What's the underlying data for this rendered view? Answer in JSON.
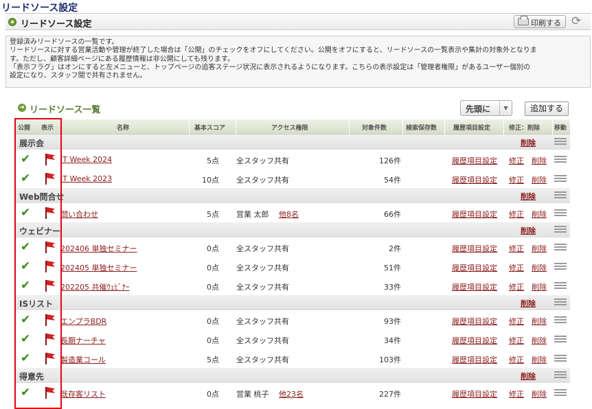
{
  "page_title": "リードソース設定",
  "section_title": "リードソース設定",
  "print_label": "印刷する",
  "description": [
    "登録済みリードソースの一覧です。",
    "リードソースに対する営業活動や管理が終了した場合は「公開」のチェックをオフにしてください。公開をオフにすると、リードソースの一覧表示や集計の対象外となりま",
    "す。ただし、顧客詳細ページにある履歴情報は非公開にしても残ります。",
    "「表示フラグ」はオンにすると左メニューと、トップページの追客ステージ状況に表示されるようになります。こちらの表示設定は「管理者権限」があるユーザー個別の",
    "設定になり、スタッフ間で共有されません。"
  ],
  "list_title": "リードソース一覧",
  "order_select": "先頭に",
  "add_button": "追加する",
  "headers": {
    "public": "公開",
    "display": "表示",
    "name": "名称",
    "score": "基本スコア",
    "access": "アクセス権限",
    "count": "対象件数",
    "saved": "検索保存数",
    "history": "履歴項目設定",
    "edit_delete": "修正：削除",
    "move": "移動"
  },
  "labels": {
    "delete": "削除",
    "edit": "修正",
    "history_setting": "履歴項目設定"
  },
  "categories": [
    {
      "name": "展示会",
      "items": [
        {
          "name": "IT Week 2024",
          "score": "5点",
          "access": "全スタッフ共有",
          "access_link": "",
          "count": "126件"
        },
        {
          "name": "IT Week 2023",
          "score": "10点",
          "access": "全スタッフ共有",
          "access_link": "",
          "count": "54件"
        }
      ]
    },
    {
      "name": "Web問合せ",
      "items": [
        {
          "name": "問い合わせ",
          "score": "5点",
          "access": "営業 太郎",
          "access_link": "他8名",
          "count": "66件"
        }
      ]
    },
    {
      "name": "ウェビナー",
      "items": [
        {
          "name": "202406 単独セミナー",
          "score": "0点",
          "access": "全スタッフ共有",
          "access_link": "",
          "count": "2件"
        },
        {
          "name": "202405 単独セミナー",
          "score": "0点",
          "access": "全スタッフ共有",
          "access_link": "",
          "count": "51件"
        },
        {
          "name": "202205 共催ｳｪﾋﾞﾅｰ",
          "score": "0点",
          "access": "全スタッフ共有",
          "access_link": "",
          "count": "33件"
        }
      ]
    },
    {
      "name": "ISリスト",
      "items": [
        {
          "name": "エンプラBDR",
          "score": "0点",
          "access": "全スタッフ共有",
          "access_link": "",
          "count": "93件"
        },
        {
          "name": "長期ナーチャ",
          "score": "0点",
          "access": "全スタッフ共有",
          "access_link": "",
          "count": "34件"
        },
        {
          "name": "製造業コール",
          "score": "5点",
          "access": "全スタッフ共有",
          "access_link": "",
          "count": "103件"
        }
      ]
    },
    {
      "name": "得意先",
      "items": [
        {
          "name": "既存客リスト",
          "score": "0点",
          "access": "営業 桃子",
          "access_link": "他23名",
          "count": "227件"
        }
      ]
    }
  ],
  "colors": {
    "accent_green": "#5c7d32",
    "link": "#8b1a1a",
    "highlight_frame": "#e60012"
  }
}
